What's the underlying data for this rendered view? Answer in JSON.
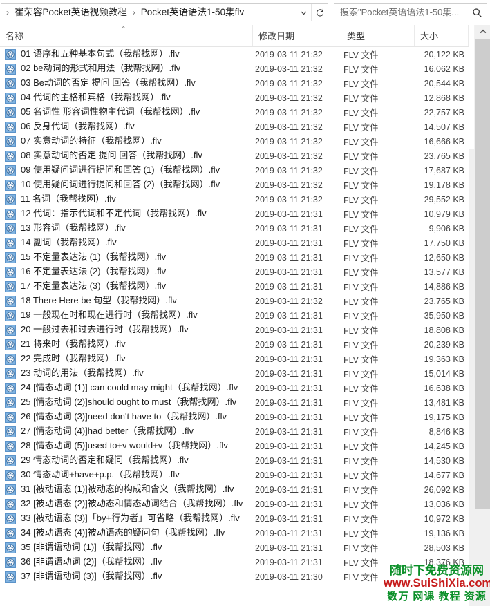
{
  "address": {
    "separator": "›",
    "crumbs": [
      "崔荣容Pocket英语视频教程",
      "Pocket英语语法1-50集flv"
    ],
    "dropdown_icon": "chevron-down-icon",
    "refresh_icon": "refresh-icon"
  },
  "search": {
    "value": "搜索\"Pocket英语语法1-50集...",
    "icon": "search-icon"
  },
  "columns": {
    "name": "名称",
    "date": "修改日期",
    "type": "类型",
    "size": "大小",
    "sort_caret": "⌃"
  },
  "scrollbar": {
    "up_arrow": "⌃"
  },
  "watermark": {
    "line1": "随时下免费资源网",
    "line2": "www.SuiShiXia.com",
    "line3": "数万 网课 教程 资源",
    "color_green": "#0a8f28",
    "color_red": "#c61a1a"
  },
  "file_type_label": "FLV 文件",
  "files": [
    {
      "name": "01 语序和五种基本句式（我帮找网）.flv",
      "date": "2019-03-11 21:32",
      "type": "FLV 文件",
      "size": "20,122 KB"
    },
    {
      "name": "02 be动词的形式和用法（我帮找网）.flv",
      "date": "2019-03-11 21:32",
      "type": "FLV 文件",
      "size": "16,062 KB"
    },
    {
      "name": "03 Be动词的否定 提问 回答（我帮找网）.flv",
      "date": "2019-03-11 21:32",
      "type": "FLV 文件",
      "size": "20,544 KB"
    },
    {
      "name": "04 代词的主格和宾格（我帮找网）.flv",
      "date": "2019-03-11 21:32",
      "type": "FLV 文件",
      "size": "12,868 KB"
    },
    {
      "name": "05 名词性 形容词性物主代词（我帮找网）.flv",
      "date": "2019-03-11 21:32",
      "type": "FLV 文件",
      "size": "22,757 KB"
    },
    {
      "name": "06 反身代词（我帮找网）.flv",
      "date": "2019-03-11 21:32",
      "type": "FLV 文件",
      "size": "14,507 KB"
    },
    {
      "name": "07 实意动词的特征（我帮找网）.flv",
      "date": "2019-03-11 21:32",
      "type": "FLV 文件",
      "size": "16,666 KB"
    },
    {
      "name": "08 实意动词的否定 提问 回答（我帮找网）.flv",
      "date": "2019-03-11 21:32",
      "type": "FLV 文件",
      "size": "23,765 KB"
    },
    {
      "name": "09 使用疑问词进行提问和回答 (1)（我帮找网）.flv",
      "date": "2019-03-11 21:32",
      "type": "FLV 文件",
      "size": "17,687 KB"
    },
    {
      "name": "10 使用疑问词进行提问和回答 (2)（我帮找网）.flv",
      "date": "2019-03-11 21:32",
      "type": "FLV 文件",
      "size": "19,178 KB"
    },
    {
      "name": "11 名词（我帮找网）.flv",
      "date": "2019-03-11 21:32",
      "type": "FLV 文件",
      "size": "29,552 KB"
    },
    {
      "name": "12 代词：指示代词和不定代词（我帮找网）.flv",
      "date": "2019-03-11 21:31",
      "type": "FLV 文件",
      "size": "10,979 KB"
    },
    {
      "name": "13 形容词（我帮找网）.flv",
      "date": "2019-03-11 21:31",
      "type": "FLV 文件",
      "size": "9,906 KB"
    },
    {
      "name": "14 副词（我帮找网）.flv",
      "date": "2019-03-11 21:31",
      "type": "FLV 文件",
      "size": "17,750 KB"
    },
    {
      "name": "15 不定量表达法 (1)（我帮找网）.flv",
      "date": "2019-03-11 21:31",
      "type": "FLV 文件",
      "size": "12,650 KB"
    },
    {
      "name": "16 不定量表达法 (2)（我帮找网）.flv",
      "date": "2019-03-11 21:31",
      "type": "FLV 文件",
      "size": "13,577 KB"
    },
    {
      "name": "17 不定量表达法 (3)（我帮找网）.flv",
      "date": "2019-03-11 21:31",
      "type": "FLV 文件",
      "size": "14,886 KB"
    },
    {
      "name": "18 There Here be 句型（我帮找网）.flv",
      "date": "2019-03-11 21:32",
      "type": "FLV 文件",
      "size": "23,765 KB"
    },
    {
      "name": "19 一般现在时和现在进行时（我帮找网）.flv",
      "date": "2019-03-11 21:31",
      "type": "FLV 文件",
      "size": "35,950 KB"
    },
    {
      "name": "20 一般过去和过去进行时（我帮找网）.flv",
      "date": "2019-03-11 21:31",
      "type": "FLV 文件",
      "size": "18,808 KB"
    },
    {
      "name": "21 将来时（我帮找网）.flv",
      "date": "2019-03-11 21:31",
      "type": "FLV 文件",
      "size": "20,239 KB"
    },
    {
      "name": "22 完成时（我帮找网）.flv",
      "date": "2019-03-11 21:31",
      "type": "FLV 文件",
      "size": "19,363 KB"
    },
    {
      "name": "23 动词的用法（我帮找网）.flv",
      "date": "2019-03-11 21:31",
      "type": "FLV 文件",
      "size": "15,014 KB"
    },
    {
      "name": "24 [情态动词 (1)] can could may might（我帮找网）.flv",
      "date": "2019-03-11 21:31",
      "type": "FLV 文件",
      "size": "16,638 KB"
    },
    {
      "name": "25 [情态动词 (2)]should ought to must（我帮找网）.flv",
      "date": "2019-03-11 21:31",
      "type": "FLV 文件",
      "size": "13,481 KB"
    },
    {
      "name": "26 [情态动词 (3)]need don't have to（我帮找网）.flv",
      "date": "2019-03-11 21:31",
      "type": "FLV 文件",
      "size": "19,175 KB"
    },
    {
      "name": "27 [情态动词 (4)]had better（我帮找网）.flv",
      "date": "2019-03-11 21:31",
      "type": "FLV 文件",
      "size": "8,846 KB"
    },
    {
      "name": "28 [情态动词 (5)]used to+v would+v（我帮找网）.flv",
      "date": "2019-03-11 21:31",
      "type": "FLV 文件",
      "size": "14,245 KB"
    },
    {
      "name": "29 情态动词的否定和疑问（我帮找网）.flv",
      "date": "2019-03-11 21:31",
      "type": "FLV 文件",
      "size": "14,530 KB"
    },
    {
      "name": "30 情态动词+have+p.p.（我帮找网）.flv",
      "date": "2019-03-11 21:31",
      "type": "FLV 文件",
      "size": "14,677 KB"
    },
    {
      "name": "31 [被动语态 (1)]被动态的构成和含义（我帮找网）.flv",
      "date": "2019-03-11 21:31",
      "type": "FLV 文件",
      "size": "26,092 KB"
    },
    {
      "name": "32 [被动语态 (2)]被动态和情态动词结合（我帮找网）.flv",
      "date": "2019-03-11 21:31",
      "type": "FLV 文件",
      "size": "13,036 KB"
    },
    {
      "name": "33 [被动语态 (3)]「by+行为者」可省略（我帮找网）.flv",
      "date": "2019-03-11 21:31",
      "type": "FLV 文件",
      "size": "10,972 KB"
    },
    {
      "name": "34 [被动语态 (4)]被动语态的疑问句（我帮找网）.flv",
      "date": "2019-03-11 21:31",
      "type": "FLV 文件",
      "size": "19,136 KB"
    },
    {
      "name": "35 [非谓语动词 (1)]（我帮找网）.flv",
      "date": "2019-03-11 21:31",
      "type": "FLV 文件",
      "size": "28,503 KB"
    },
    {
      "name": "36 [非谓语动词 (2)]（我帮找网）.flv",
      "date": "2019-03-11 21:31",
      "type": "FLV 文件",
      "size": "18,376 KB"
    },
    {
      "name": "37 [非谓语动词 (3)]（我帮找网）.flv",
      "date": "2019-03-11 21:30",
      "type": "FLV 文件",
      "size": ""
    }
  ]
}
